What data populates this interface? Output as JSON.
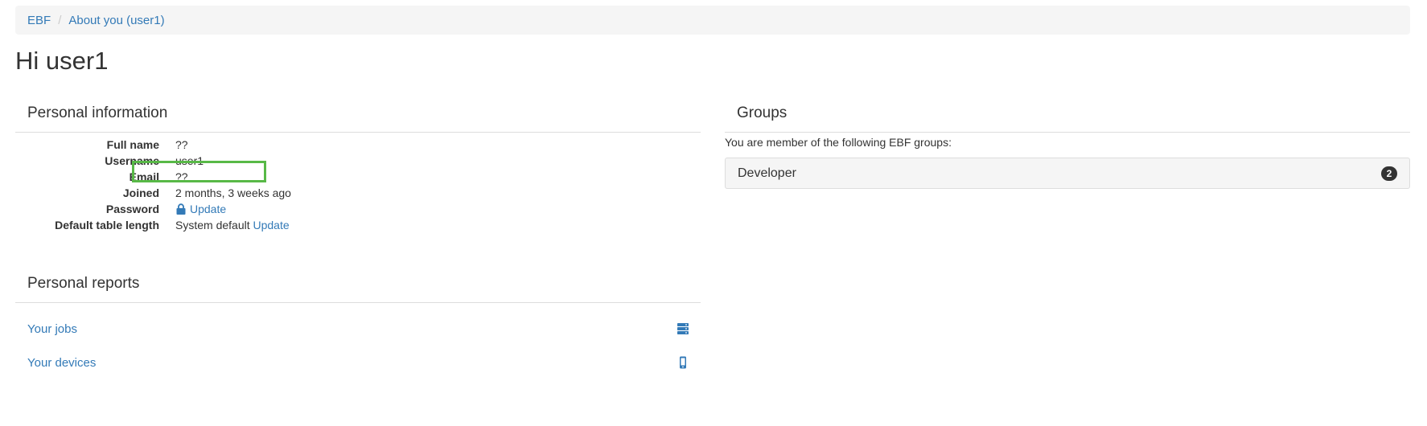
{
  "breadcrumb": {
    "items": [
      "EBF",
      "About you (user1)"
    ],
    "separator": "/"
  },
  "page": {
    "title": "Hi user1"
  },
  "personal_info": {
    "heading": "Personal information",
    "rows": [
      {
        "label": "Full name",
        "value": "??"
      },
      {
        "label": "Username",
        "value": "user1"
      },
      {
        "label": "Email",
        "value": "??"
      },
      {
        "label": "Joined",
        "value": "2 months, 3 weeks ago"
      },
      {
        "label": "Password",
        "link": "Update",
        "icon": "lock-icon"
      },
      {
        "label": "Default table length",
        "value": "System default",
        "link": "Update"
      }
    ]
  },
  "personal_reports": {
    "heading": "Personal reports",
    "items": [
      {
        "label": "Your jobs",
        "icon": "server-icon"
      },
      {
        "label": "Your devices",
        "icon": "mobile-icon"
      }
    ]
  },
  "groups": {
    "heading": "Groups",
    "intro": "You are member of the following EBF groups:",
    "items": [
      {
        "name": "Developer",
        "count": "2"
      }
    ]
  },
  "colors": {
    "link": "#337ab7",
    "highlight": "#58b947",
    "badge": "#333333",
    "well": "#f5f5f5"
  }
}
